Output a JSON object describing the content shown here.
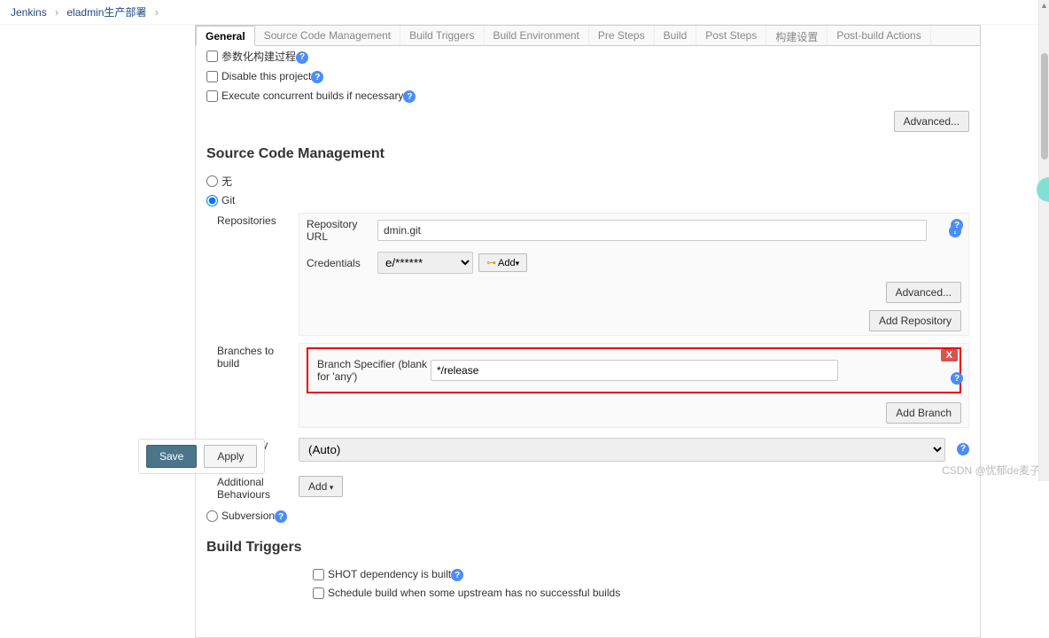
{
  "breadcrumb": {
    "root": "Jenkins",
    "project": "eladmin生产部署"
  },
  "tabs": [
    "General",
    "Source Code Management",
    "Build Triggers",
    "Build Environment",
    "Pre Steps",
    "Build",
    "Post Steps",
    "构建设置",
    "Post-build Actions"
  ],
  "general": {
    "opt_param": "参数化构建过程",
    "opt_disable": "Disable this project",
    "opt_concurrent": "Execute concurrent builds if necessary",
    "advanced": "Advanced..."
  },
  "scm": {
    "heading": "Source Code Management",
    "radio_none": "无",
    "radio_git": "Git",
    "radio_svn": "Subversion",
    "repos_label": "Repositories",
    "repo_url_label": "Repository URL",
    "repo_url_value": "dmin.git",
    "cred_label": "Credentials",
    "cred_selected": "e/******",
    "add_cred": "Add",
    "advanced": "Advanced...",
    "add_repo": "Add Repository",
    "branches_label": "Branches to build",
    "branch_spec_label": "Branch Specifier (blank for 'any')",
    "branch_value": "*/release",
    "delete_x": "X",
    "add_branch": "Add Branch",
    "repo_browser_label": "Repository browser",
    "repo_browser_value": "(Auto)",
    "addl_behaviours_label": "Additional Behaviours",
    "add_behaviour": "Add"
  },
  "triggers": {
    "heading": "Build Triggers",
    "opt_snapshot": "SHOT dependency is built",
    "opt_upstream": "Schedule build when some upstream has no successful builds"
  },
  "footer": {
    "save": "Save",
    "apply": "Apply"
  },
  "watermark": "CSDN @忧郁de麦子"
}
